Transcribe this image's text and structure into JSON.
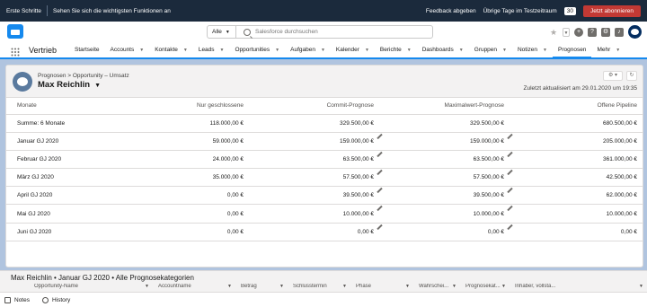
{
  "topbar": {
    "first_steps": "Erste Schritte",
    "tip": "Sehen Sie sich die wichtigsten Funktionen an",
    "feedback": "Feedback abgeben",
    "trial_label": "Übrige Tage im Testzeitraum",
    "trial_days": "30",
    "subscribe": "Jetzt abonnieren"
  },
  "header": {
    "scope": "Alle",
    "search_placeholder": "Salesforce durchsuchen"
  },
  "nav": {
    "app_name": "Vertrieb",
    "items": [
      {
        "label": "Startseite",
        "has_menu": false
      },
      {
        "label": "Accounts",
        "has_menu": true
      },
      {
        "label": "Kontakte",
        "has_menu": true
      },
      {
        "label": "Leads",
        "has_menu": true
      },
      {
        "label": "Opportunities",
        "has_menu": true
      },
      {
        "label": "Aufgaben",
        "has_menu": true
      },
      {
        "label": "Kalender",
        "has_menu": true
      },
      {
        "label": "Berichte",
        "has_menu": true
      },
      {
        "label": "Dashboards",
        "has_menu": true
      },
      {
        "label": "Gruppen",
        "has_menu": true
      },
      {
        "label": "Notizen",
        "has_menu": true
      },
      {
        "label": "Prognosen",
        "has_menu": false,
        "active": true
      },
      {
        "label": "Mehr",
        "has_menu": true
      }
    ]
  },
  "forecast": {
    "breadcrumb": "Prognosen  >  Opportunity – Umsatz",
    "owner": "Max Reichlin",
    "updated": "Zuletzt aktualisiert am 29.01.2020 um 19:35",
    "columns": [
      "Monate",
      "Nur geschlossene",
      "Commit-Prognose",
      "Maximalwert-Prognose",
      "Offene Pipeline"
    ],
    "rows": [
      {
        "month": "Summe: 6 Monate",
        "closed": "118.000,00 €",
        "commit": "329.500,00 €",
        "max": "329.500,00 €",
        "pipeline": "680.500,00 €",
        "editable": false
      },
      {
        "month": "Januar GJ 2020",
        "closed": "59.000,00 €",
        "commit": "159.000,00 €",
        "max": "159.000,00 €",
        "pipeline": "205.000,00 €",
        "editable": true
      },
      {
        "month": "Februar GJ 2020",
        "closed": "24.000,00 €",
        "commit": "63.500,00 €",
        "max": "63.500,00 €",
        "pipeline": "361.000,00 €",
        "editable": true
      },
      {
        "month": "März GJ 2020",
        "closed": "35.000,00 €",
        "commit": "57.500,00 €",
        "max": "57.500,00 €",
        "pipeline": "42.500,00 €",
        "editable": true
      },
      {
        "month": "April GJ 2020",
        "closed": "0,00 €",
        "commit": "39.500,00 €",
        "max": "39.500,00 €",
        "pipeline": "62.000,00 €",
        "editable": true
      },
      {
        "month": "Mai GJ 2020",
        "closed": "0,00 €",
        "commit": "10.000,00 €",
        "max": "10.000,00 €",
        "pipeline": "10.000,00 €",
        "editable": true
      },
      {
        "month": "Juni GJ 2020",
        "closed": "0,00 €",
        "commit": "0,00 €",
        "max": "0,00 €",
        "pipeline": "0,00 €",
        "editable": true
      }
    ]
  },
  "detail": {
    "title": "Max Reichlin  •  Januar GJ 2020  •  Alle Prognosekategorien",
    "columns": [
      "Opportunity-Name",
      "Accountname",
      "Betrag",
      "Schlusstermin",
      "Phase",
      "Wahrschei...",
      "Prognosekat...",
      "Inhaber, vollstä..."
    ]
  },
  "utility": {
    "notes": "Notes",
    "history": "History"
  },
  "colors": {
    "brand": "#1589ee",
    "topbar": "#1b2a3c",
    "subscribe": "#c23934",
    "background": "#b0c4df"
  }
}
